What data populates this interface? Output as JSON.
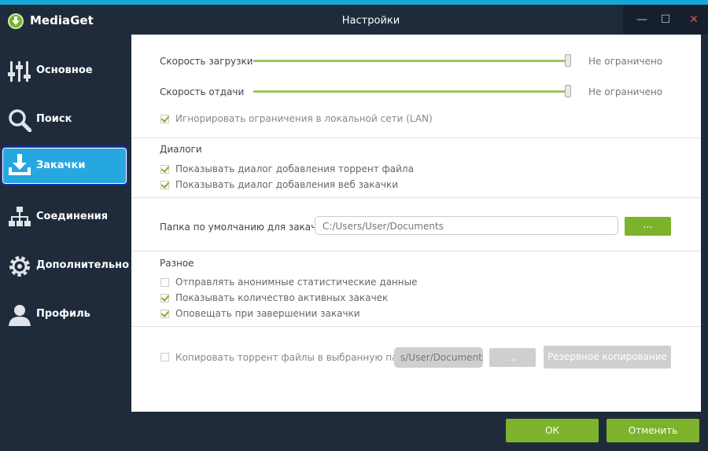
{
  "app": {
    "name": "MediaGet",
    "window_title": "Настройки"
  },
  "window_controls": {
    "minimize": "—",
    "maximize": "☐",
    "close": "✕"
  },
  "sidebar": {
    "items": [
      {
        "label": "Основное",
        "icon": "equalizer-icon"
      },
      {
        "label": "Поиск",
        "icon": "search-icon"
      },
      {
        "label": "Закачки",
        "icon": "download-icon",
        "active": true
      },
      {
        "label": "Соединения",
        "icon": "network-icon"
      },
      {
        "label": "Дополнительно",
        "icon": "gear-icon"
      },
      {
        "label": "Профиль",
        "icon": "user-icon"
      }
    ]
  },
  "speed": {
    "download_label": "Скорость загрузки",
    "download_value": "Не ограничено",
    "download_level": 1.0,
    "upload_label": "Скорость отдачи",
    "upload_value": "Не ограничено",
    "upload_level": 1.0,
    "ignore_lan_label": "Игнорировать ограничения в локальной сети (LAN)",
    "ignore_lan_checked": true
  },
  "dialogs": {
    "title": "Диалоги",
    "torrent_dialog_label": "Показывать диалог добавления торрент файла",
    "web_dialog_label": "Показывать диалог добавления веб закачки"
  },
  "folder": {
    "label": "Папка по умолчанию для закачек",
    "path": "C:/Users/User/Documents",
    "browse_label": "..."
  },
  "misc": {
    "title": "Разное",
    "anon_stats_label": "Отправлять анонимные статистические данные",
    "show_active_label": "Показывать количество активных закачек",
    "notify_done_label": "Оповещать при завершении закачки"
  },
  "copy": {
    "label": "Копировать торрент файлы в выбранную папку",
    "path": "s/User/Documents",
    "browse_label": "...",
    "backup_label": "Резервное копирование"
  },
  "footer": {
    "ok_label": "ОК",
    "cancel_label": "Отменить"
  },
  "colors": {
    "accent_green": "#7cb32b",
    "active_blue": "#27a7e0",
    "sidebar_bg": "#1f2b3a",
    "top_line": "#17a7d6"
  }
}
